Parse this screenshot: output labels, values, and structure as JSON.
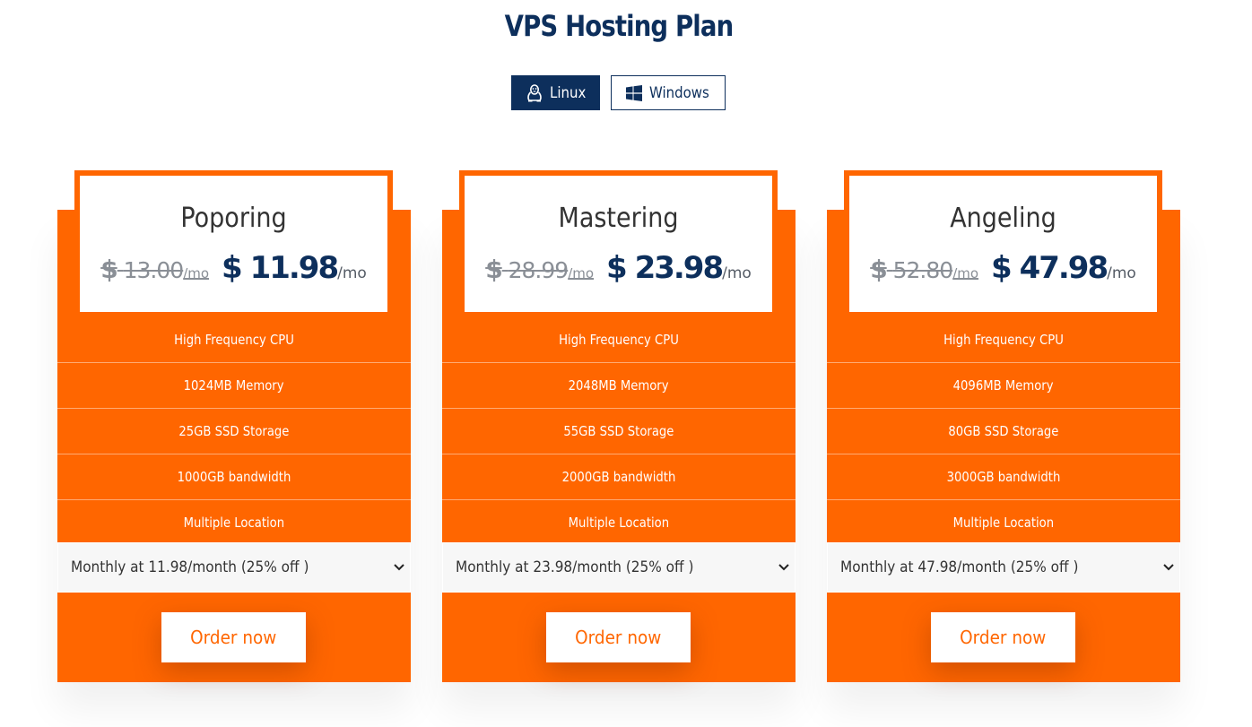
{
  "page": {
    "title": "VPS Hosting Plan"
  },
  "os_tabs": [
    {
      "label": "Linux",
      "icon": "linux-tux-icon",
      "active": true
    },
    {
      "label": "Windows",
      "icon": "windows-logo-icon",
      "active": false
    }
  ],
  "colors": {
    "brand_orange": "#ff6600",
    "navy": "#0d2f5c",
    "old_price_gray": "#8a8f96"
  },
  "plans": [
    {
      "name": "Poporing",
      "old_price": {
        "currency": "$",
        "amount": "13.00",
        "unit": "/mo"
      },
      "price": {
        "currency": "$",
        "amount": "11.98",
        "unit": "/mo"
      },
      "features": [
        "High Frequency CPU",
        "1024MB Memory",
        "25GB SSD Storage",
        "1000GB bandwidth",
        "Multiple Location"
      ],
      "billing_cycle": "Monthly at 11.98/month (25% off )",
      "order_label": "Order now"
    },
    {
      "name": "Mastering",
      "old_price": {
        "currency": "$",
        "amount": "28.99",
        "unit": "/mo"
      },
      "price": {
        "currency": "$",
        "amount": "23.98",
        "unit": "/mo"
      },
      "features": [
        "High Frequency CPU",
        "2048MB Memory",
        "55GB SSD Storage",
        "2000GB bandwidth",
        "Multiple Location"
      ],
      "billing_cycle": "Monthly at 23.98/month (25% off )",
      "order_label": "Order now"
    },
    {
      "name": "Angeling",
      "old_price": {
        "currency": "$",
        "amount": "52.80",
        "unit": "/mo"
      },
      "price": {
        "currency": "$",
        "amount": "47.98",
        "unit": "/mo"
      },
      "features": [
        "High Frequency CPU",
        "4096MB Memory",
        "80GB SSD Storage",
        "3000GB bandwidth",
        "Multiple Location"
      ],
      "billing_cycle": "Monthly at 47.98/month (25% off )",
      "order_label": "Order now"
    }
  ]
}
